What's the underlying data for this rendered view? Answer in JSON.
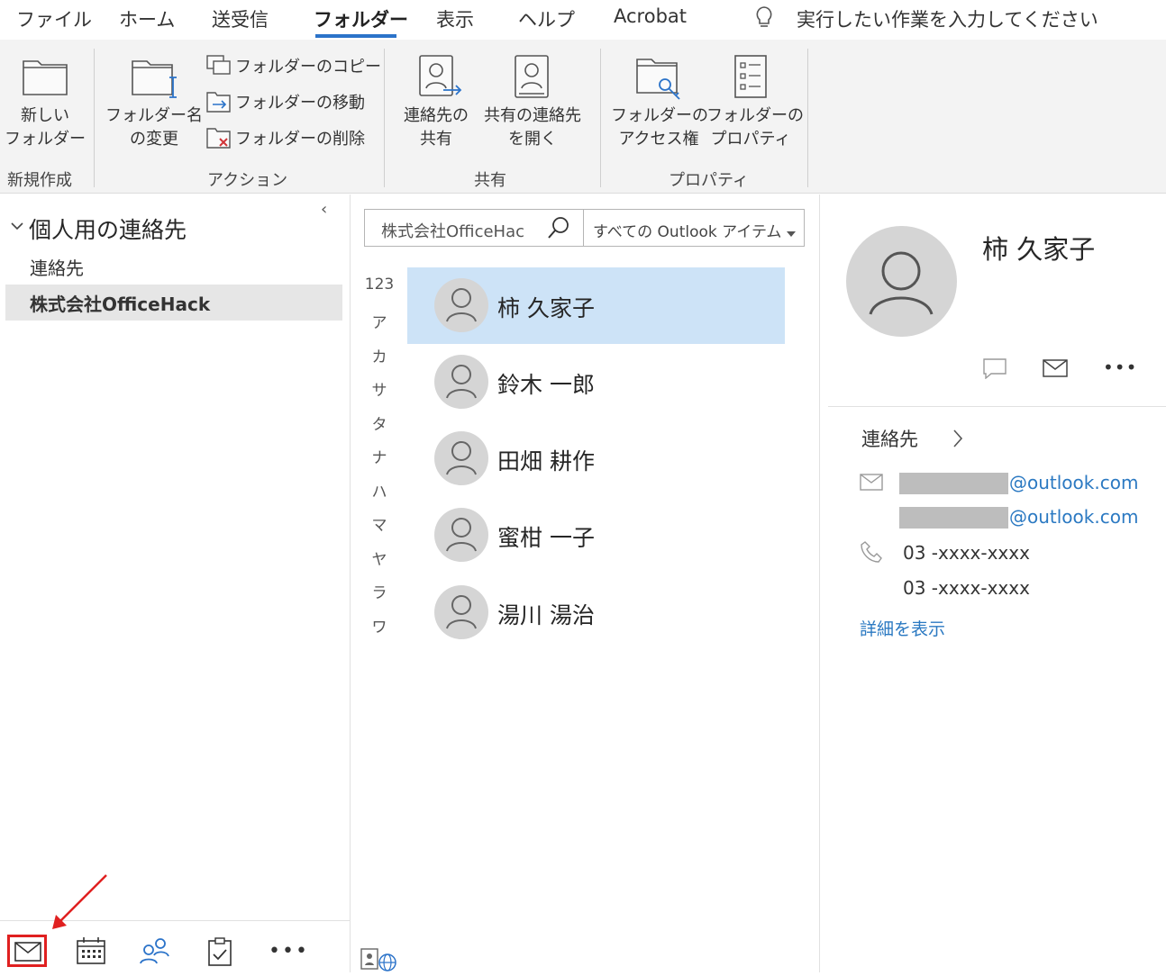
{
  "ribbon": {
    "tabs": [
      "ファイル",
      "ホーム",
      "送受信",
      "フォルダー",
      "表示",
      "ヘルプ",
      "Acrobat"
    ],
    "active_tab": "フォルダー",
    "tell_me": "実行したい作業を入力してください",
    "new_folder": [
      "新しい",
      "フォルダー"
    ],
    "rename_folder": [
      "フォルダー名",
      "の変更"
    ],
    "copy_folder": "フォルダーのコピー",
    "move_folder": "フォルダーの移動",
    "delete_folder": "フォルダーの削除",
    "share_contacts": [
      "連絡先の",
      "共有"
    ],
    "open_shared_contacts": [
      "共有の連絡先",
      "を開く"
    ],
    "folder_permissions": [
      "フォルダーの",
      "アクセス権"
    ],
    "folder_properties": [
      "フォルダーの",
      "プロパティ"
    ],
    "groups": {
      "new": "新規作成",
      "actions": "アクション",
      "share": "共有",
      "properties": "プロパティ"
    }
  },
  "nav": {
    "section": "個人用の連絡先",
    "items": [
      "連絡先",
      "株式会社OfficeHack"
    ],
    "selected_index": 1
  },
  "search": {
    "value": "株式会社OfficeHac",
    "scope": "すべての Outlook アイテム"
  },
  "alpha_index": [
    "123",
    "ア",
    "カ",
    "サ",
    "タ",
    "ナ",
    "ハ",
    "マ",
    "ヤ",
    "ラ",
    "ワ"
  ],
  "contacts": [
    "柿 久家子",
    "鈴木 一郎",
    "田畑 耕作",
    "蜜柑 一子",
    "湯川 湯治"
  ],
  "selected_contact_index": 0,
  "detail": {
    "name": "柿 久家子",
    "section": "連絡先",
    "email_domain": "@outlook.com",
    "phone1": "03 -xxxx-xxxx",
    "phone2": "03 -xxxx-xxxx",
    "show_details": "詳細を表示"
  },
  "colors": {
    "accent": "#2b73c9",
    "selection": "#cde3f7",
    "highlight_box": "#e02020"
  }
}
